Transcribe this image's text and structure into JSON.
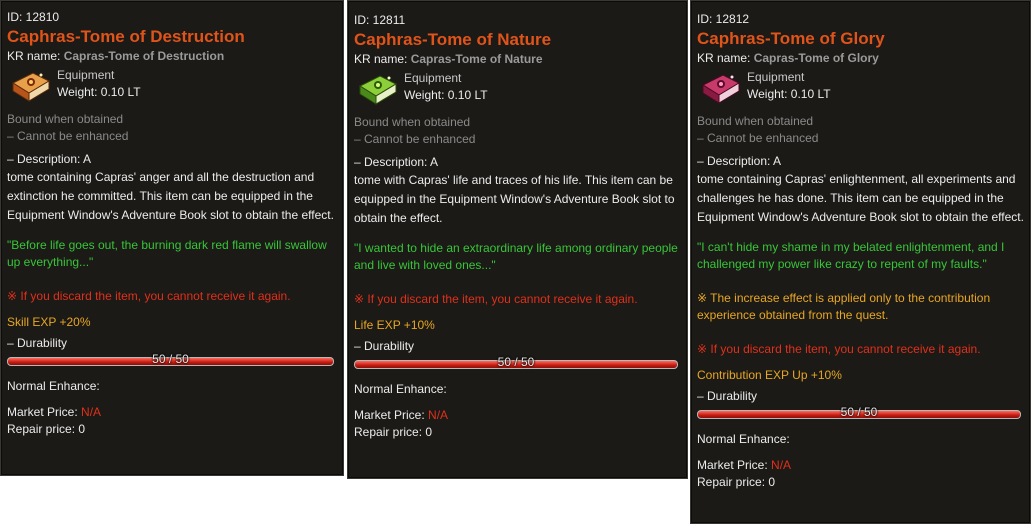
{
  "colors": {
    "name": "#e0541a",
    "quote": "#38c538",
    "warning": "#e0301a",
    "bonus": "#e8a623",
    "bound": "#8a8a8a",
    "panel_bg": "#1b1a17"
  },
  "items": [
    {
      "id_label": "ID: 12810",
      "name": "Caphras-Tome of Destruction",
      "kr_label": "KR name:",
      "kr_value": "Capras-Tome of Destruction",
      "icon": "orange-book-icon",
      "category": "Equipment",
      "weight": "Weight: 0.10 LT",
      "bound": "Bound when obtained",
      "cannot_enhance": "– Cannot be enhanced",
      "desc_head": "– Description: A",
      "desc_body": "tome containing Capras' anger and all the destruction and extinction he committed. This item can be equipped in the Equipment Window's Adventure Book slot to obtain the effect.",
      "quote": "\"Before life goes out, the burning dark red flame will swallow up everything...\"",
      "note": "",
      "warning": "※ If you discard the item, you cannot receive it again.",
      "bonus": "Skill EXP +20%",
      "durability_label": "– Durability",
      "durability_text": "50 / 50",
      "durability_fraction": 1.0,
      "normal_enhance": "Normal Enhance:",
      "market_label": "Market Price:",
      "market_value": "N/A",
      "repair": "Repair price: 0"
    },
    {
      "id_label": "ID: 12811",
      "name": "Caphras-Tome of Nature",
      "kr_label": "KR name:",
      "kr_value": "Capras-Tome of Nature",
      "icon": "green-book-icon",
      "category": "Equipment",
      "weight": "Weight: 0.10 LT",
      "bound": "Bound when obtained",
      "cannot_enhance": "– Cannot be enhanced",
      "desc_head": "– Description: A",
      "desc_body": "tome with Capras' life and traces of his life. This item can be equipped in the Equipment Window's Adventure Book slot to obtain the effect.",
      "quote": "\"I wanted to hide an extraordinary life among ordinary people and live with loved ones...\"",
      "note": "",
      "warning": "※ If you discard the item, you cannot receive it again.",
      "bonus": "Life EXP +10%",
      "durability_label": "– Durability",
      "durability_text": "50 / 50",
      "durability_fraction": 1.0,
      "normal_enhance": "Normal Enhance:",
      "market_label": "Market Price:",
      "market_value": "N/A",
      "repair": "Repair price: 0"
    },
    {
      "id_label": "ID: 12812",
      "name": "Caphras-Tome of Glory",
      "kr_label": "KR name:",
      "kr_value": "Capras-Tome of Glory",
      "icon": "pink-book-icon",
      "category": "Equipment",
      "weight": "Weight: 0.10 LT",
      "bound": "Bound when obtained",
      "cannot_enhance": "– Cannot be enhanced",
      "desc_head": "– Description: A",
      "desc_body": "tome containing Capras' enlightenment, all experiments and challenges he has done. This item can be equipped in the Equipment Window's Adventure Book slot to obtain the effect.",
      "quote": "\"I can't hide my shame in my belated enlightenment, and I challenged my power like crazy to repent of my faults.\"",
      "note": "※ The increase effect is applied only to the contribution experience obtained from the quest.",
      "warning": "※ If you discard the item, you cannot receive it again.",
      "bonus": "Contribution EXP Up +10%",
      "durability_label": "– Durability",
      "durability_text": "50 / 50",
      "durability_fraction": 1.0,
      "normal_enhance": "Normal Enhance:",
      "market_label": "Market Price:",
      "market_value": "N/A",
      "repair": "Repair price: 0"
    }
  ]
}
